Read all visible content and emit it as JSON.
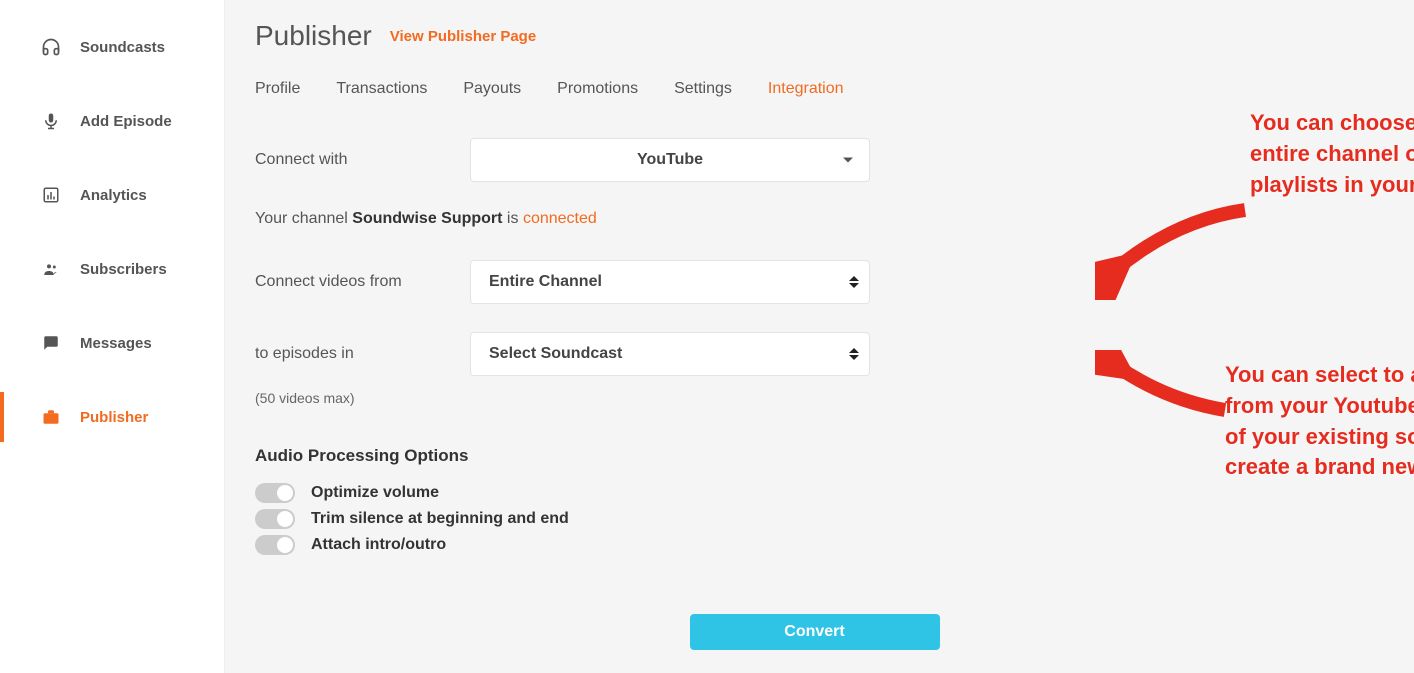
{
  "sidebar": {
    "items": [
      {
        "label": "Soundcasts",
        "icon": "headphones-icon"
      },
      {
        "label": "Add Episode",
        "icon": "mic-icon"
      },
      {
        "label": "Analytics",
        "icon": "chart-icon"
      },
      {
        "label": "Subscribers",
        "icon": "people-icon"
      },
      {
        "label": "Messages",
        "icon": "message-icon"
      },
      {
        "label": "Publisher",
        "icon": "briefcase-icon"
      }
    ]
  },
  "header": {
    "title": "Publisher",
    "view_link": "View Publisher Page"
  },
  "tabs": {
    "items": [
      "Profile",
      "Transactions",
      "Payouts",
      "Promotions",
      "Settings",
      "Integration"
    ],
    "active_index": 5
  },
  "form": {
    "connect_with_label": "Connect with",
    "connect_with_value": "YouTube",
    "status_prefix": "Your channel ",
    "status_channel": "Soundwise Support",
    "status_mid": " is ",
    "status_state": "connected",
    "videos_from_label": "Connect videos from",
    "videos_from_value": "Entire Channel",
    "episodes_in_label": "to episodes in",
    "episodes_in_value": "Select Soundcast",
    "hint": "(50 videos max)",
    "audio_options_title": "Audio Processing Options",
    "options": [
      "Optimize volume",
      "Trim silence at beginning and end",
      "Attach intro/outro"
    ],
    "convert_label": "Convert"
  },
  "annotations": {
    "a1": "You can choose to convert the entire channel or one of the playlists in your channel.",
    "a2": "You can select to add the content from your Youtube channel to one of your existing soundcasts, or to create a brand new soundcast."
  },
  "colors": {
    "accent": "#f26b21",
    "button": "#2fc4e6",
    "annotation": "#e62c1f"
  }
}
